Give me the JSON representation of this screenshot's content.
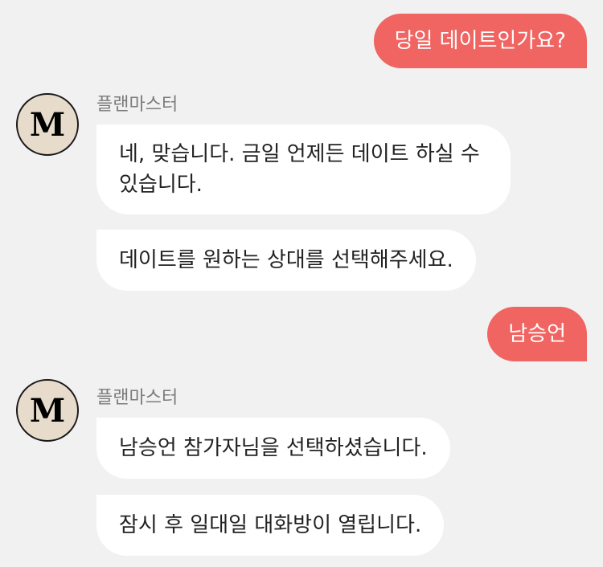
{
  "colors": {
    "background": "#f1f1f1",
    "user_bubble": "#f06461",
    "bot_bubble": "#ffffff",
    "avatar_bg": "#e7dccc"
  },
  "messages": [
    {
      "role": "user",
      "text": "당일 데이트인가요?"
    },
    {
      "role": "bot",
      "sender": "플랜마스터",
      "avatar": "M",
      "texts": [
        "네, 맞습니다. 금일 언제든 데이트 하실 수 있습니다.",
        "데이트를 원하는 상대를 선택해주세요."
      ]
    },
    {
      "role": "user",
      "text": "남승언"
    },
    {
      "role": "bot",
      "sender": "플랜마스터",
      "avatar": "M",
      "texts": [
        "남승언 참가자님을 선택하셨습니다.",
        "잠시 후 일대일 대화방이 열립니다."
      ]
    }
  ]
}
